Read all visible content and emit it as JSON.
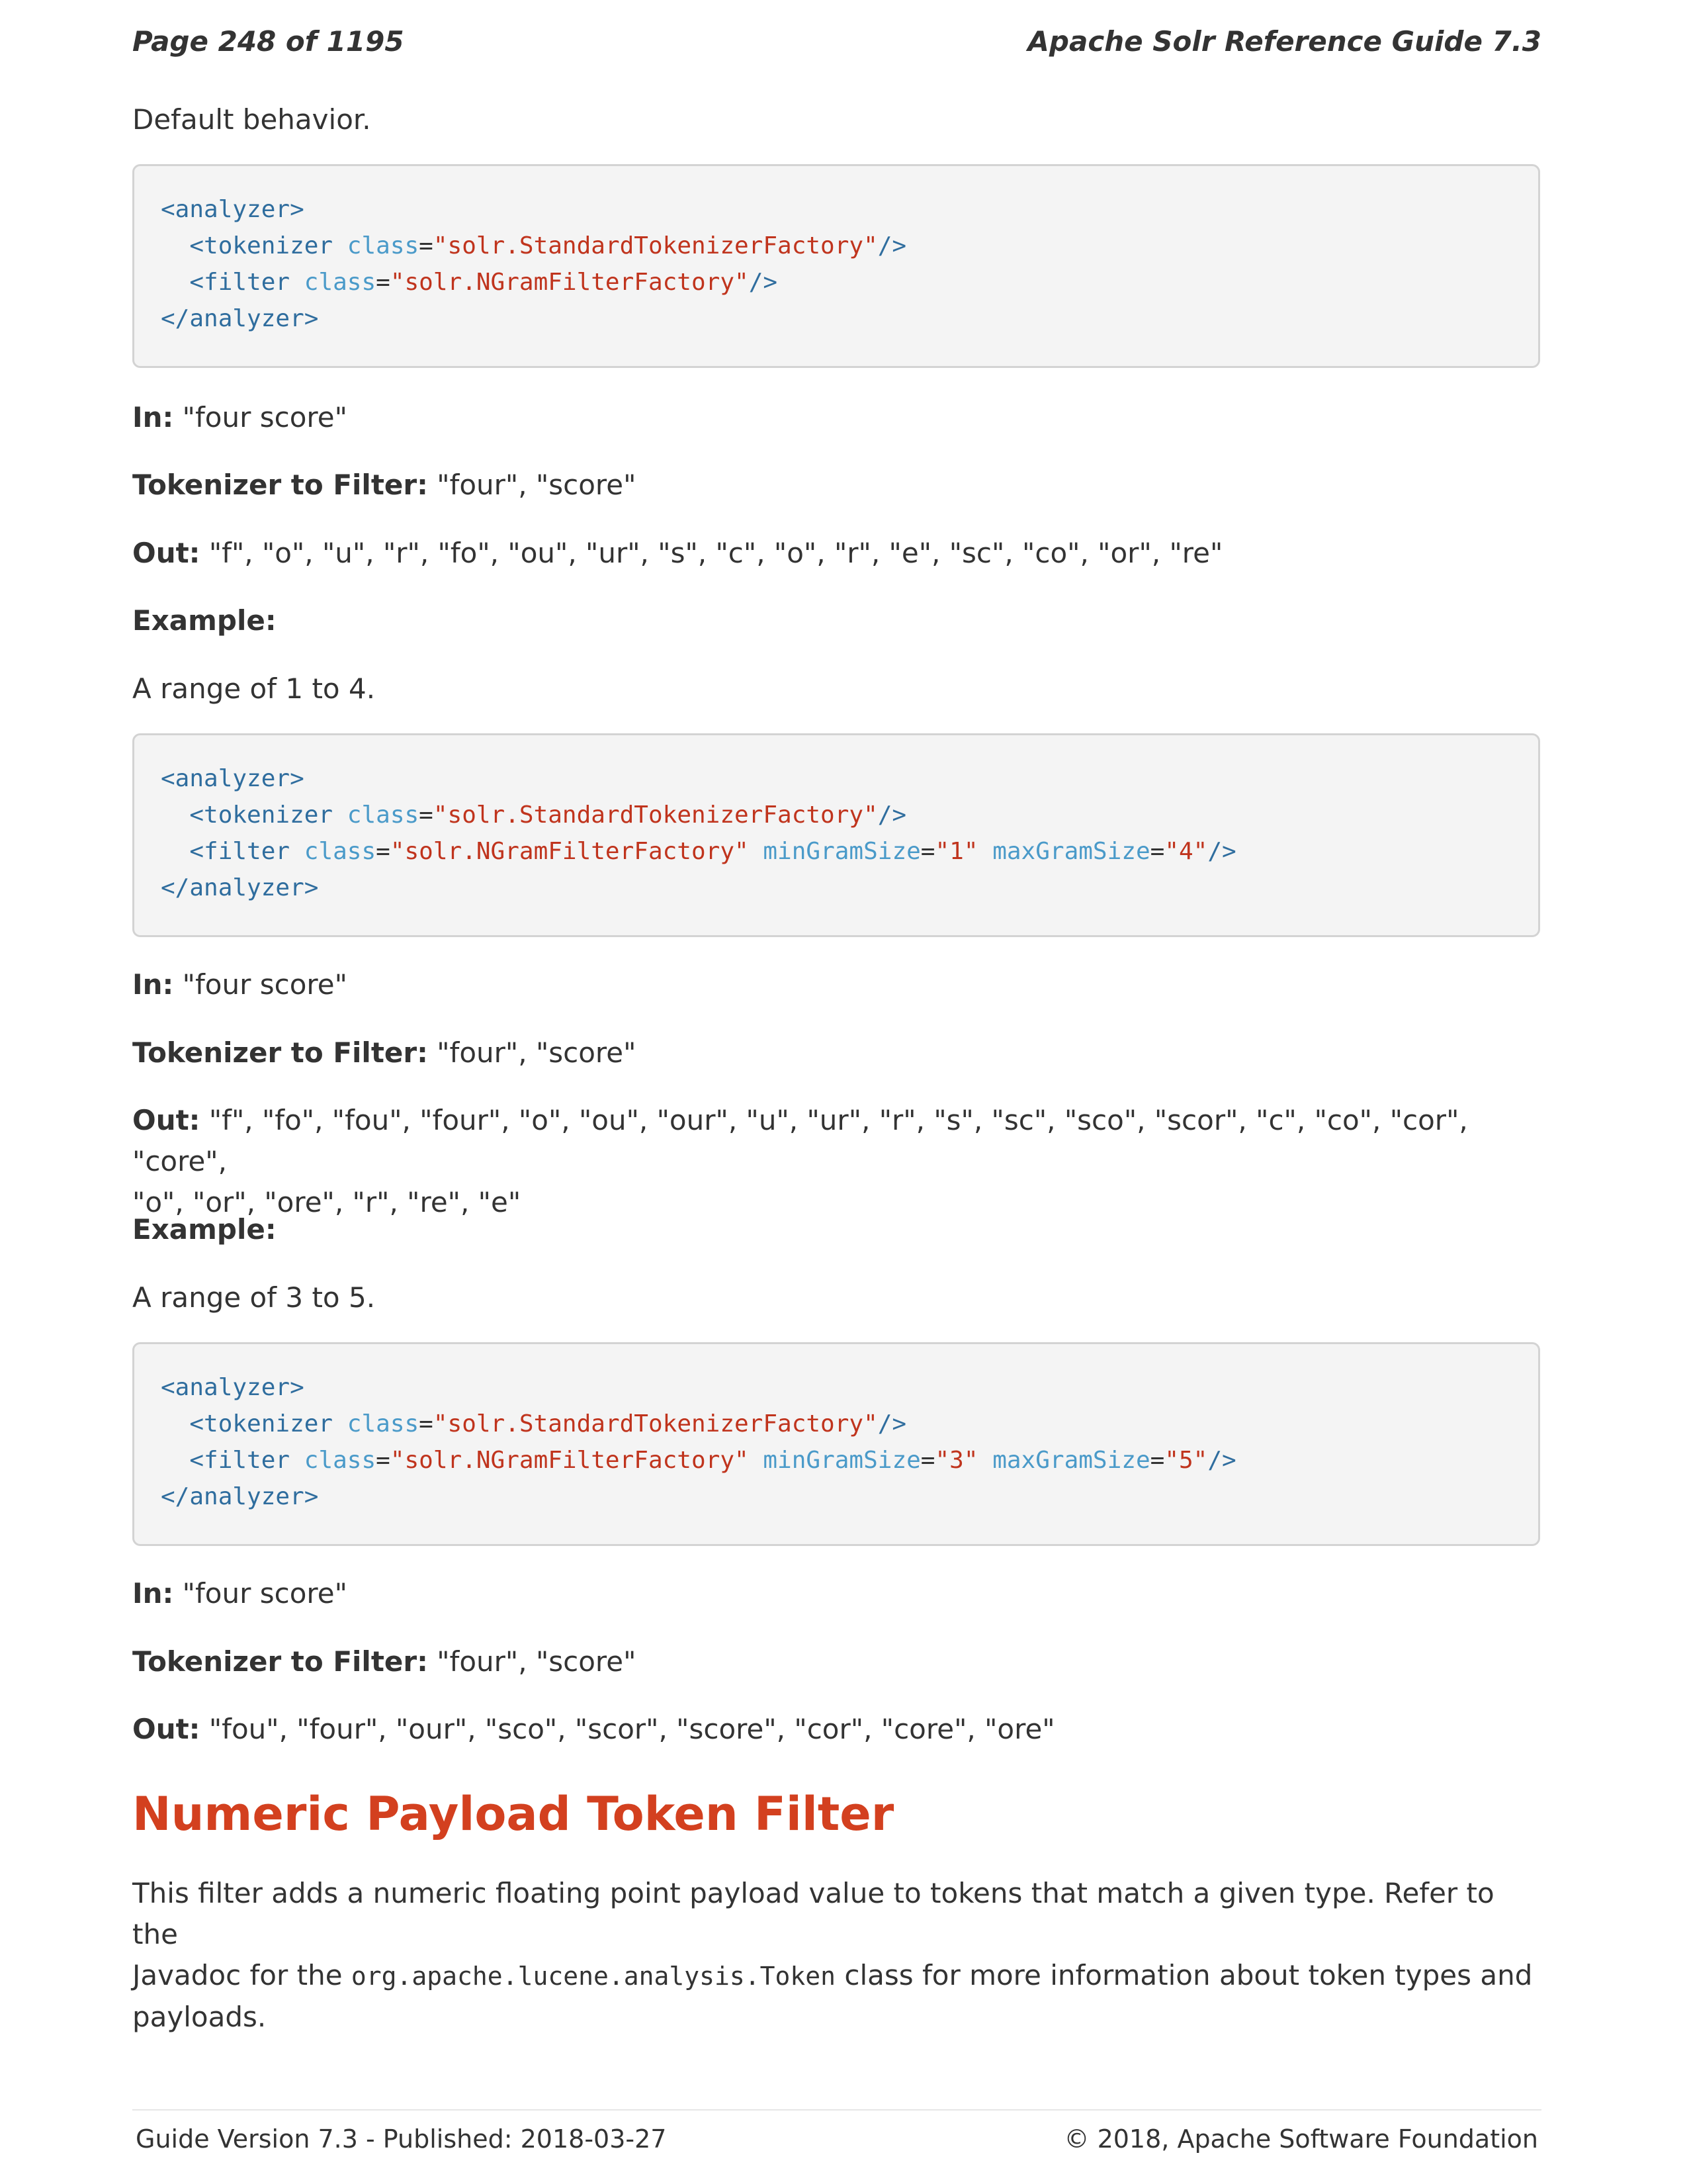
{
  "header": {
    "page_label": "Page 248 of 1195",
    "guide_title": "Apache Solr Reference Guide 7.3"
  },
  "intro_text": "Default behavior.",
  "code_blocks": [
    {
      "lines": [
        {
          "open": "<analyzer>"
        },
        {
          "indent": "  ",
          "open": "<tokenizer",
          "attr1": "class",
          "eq1": "=",
          "val1": "\"solr.StandardTokenizerFactory\"",
          "close": "/>"
        },
        {
          "indent": "  ",
          "open": "<filter",
          "attr1": "class",
          "eq1": "=",
          "val1": "\"solr.NGramFilterFactory\"",
          "close": "/>"
        },
        {
          "open": "</analyzer>"
        }
      ]
    },
    {
      "lines": [
        {
          "open": "<analyzer>"
        },
        {
          "indent": "  ",
          "open": "<tokenizer",
          "attr1": "class",
          "eq1": "=",
          "val1": "\"solr.StandardTokenizerFactory\"",
          "close": "/>"
        },
        {
          "indent": "  ",
          "open": "<filter",
          "attr1": "class",
          "eq1": "=",
          "val1": "\"solr.NGramFilterFactory\"",
          "attr2": "minGramSize",
          "eq2": "=",
          "val2": "\"1\"",
          "attr3": "maxGramSize",
          "eq3": "=",
          "val3": "\"4\"",
          "close": "/>"
        },
        {
          "open": "</analyzer>"
        }
      ]
    },
    {
      "lines": [
        {
          "open": "<analyzer>"
        },
        {
          "indent": "  ",
          "open": "<tokenizer",
          "attr1": "class",
          "eq1": "=",
          "val1": "\"solr.StandardTokenizerFactory\"",
          "close": "/>"
        },
        {
          "indent": "  ",
          "open": "<filter",
          "attr1": "class",
          "eq1": "=",
          "val1": "\"solr.NGramFilterFactory\"",
          "attr2": "minGramSize",
          "eq2": "=",
          "val2": "\"3\"",
          "attr3": "maxGramSize",
          "eq3": "=",
          "val3": "\"5\"",
          "close": "/>"
        },
        {
          "open": "</analyzer>"
        }
      ]
    }
  ],
  "labels": {
    "in": "In:",
    "tokenizer_to_filter": "Tokenizer to Filter:",
    "out": "Out:",
    "example": "Example:"
  },
  "examples": [
    {
      "in": " \"four score\"",
      "tokenizer_to_filter": " \"four\", \"score\"",
      "out": " \"f\", \"o\", \"u\", \"r\", \"fo\", \"ou\", \"ur\", \"s\", \"c\", \"o\", \"r\", \"e\", \"sc\", \"co\", \"or\", \"re\""
    },
    {
      "range_text": "A range of 1 to 4.",
      "in": " \"four score\"",
      "tokenizer_to_filter": " \"four\", \"score\"",
      "out": " \"f\", \"fo\", \"fou\", \"four\", \"o\", \"ou\", \"our\", \"u\", \"ur\", \"r\", \"s\", \"sc\", \"sco\", \"scor\", \"c\", \"co\", \"cor\", \"core\",",
      "out_cont": "\"o\", \"or\", \"ore\", \"r\", \"re\", \"e\""
    },
    {
      "range_text": "A range of 3 to 5.",
      "in": " \"four score\"",
      "tokenizer_to_filter": " \"four\", \"score\"",
      "out": " \"fou\", \"four\", \"our\", \"sco\", \"scor\", \"score\", \"cor\", \"core\", \"ore\""
    }
  ],
  "section": {
    "title": "Numeric Payload Token Filter",
    "body_part1": "This filter adds a numeric floating point payload value to tokens that match a given type. Refer to the",
    "body_part2a": "Javadoc for the ",
    "body_code": "org.apache.lucene.analysis.Token",
    "body_part2b": " class for more information about token types and",
    "body_part3": "payloads."
  },
  "footer": {
    "version": "Guide Version 7.3 - Published: 2018-03-27",
    "copyright": "© 2018, Apache Software Foundation"
  }
}
